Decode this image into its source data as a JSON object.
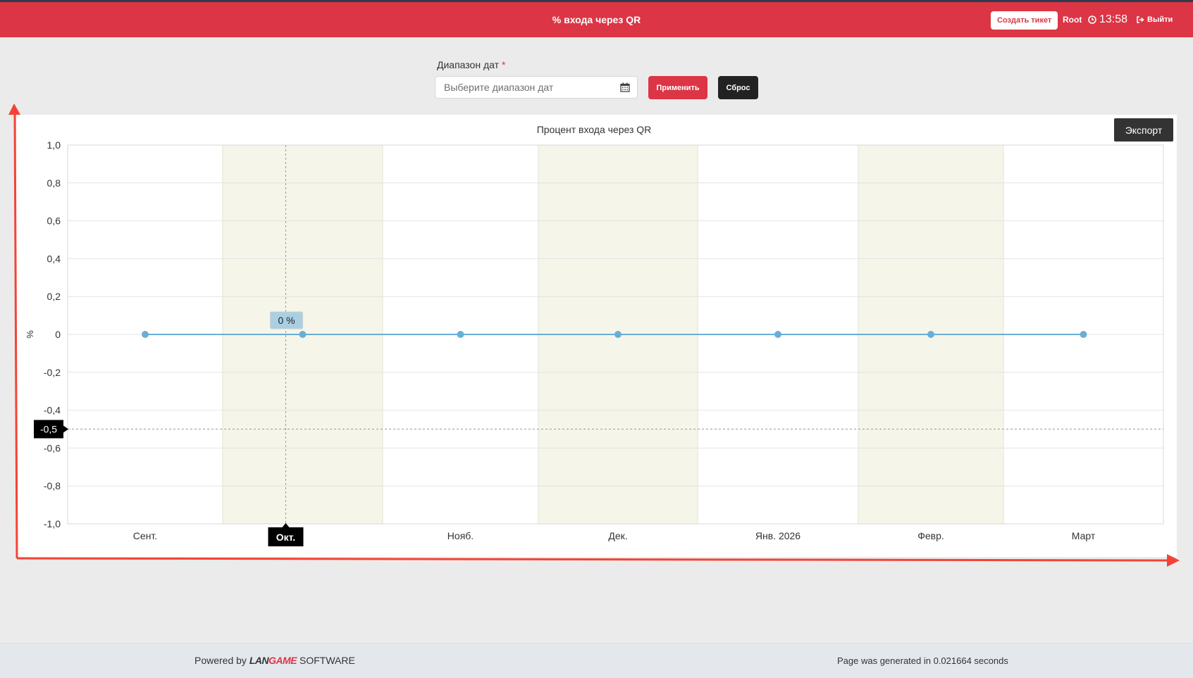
{
  "header": {
    "title": "% входа через QR",
    "create_ticket_label": "Создать тикет",
    "user": "Root",
    "time": "13:58",
    "logout_label": "Выйти",
    "bg_color": "#dc3545"
  },
  "filter": {
    "label": "Диапазон дат",
    "required_mark": "*",
    "placeholder": "Выберите диапазон дат",
    "value": "",
    "apply_label": "Применить",
    "reset_label": "Сброс"
  },
  "export_label": "Экспорт",
  "chart_data": {
    "type": "line",
    "title": "Процент входа через QR",
    "ylabel": "%",
    "xlabel": "",
    "categories": [
      "Сент.",
      "Окт.",
      "Нояб.",
      "Дек.",
      "Янв. 2026",
      "Февр.",
      "Март"
    ],
    "series": [
      {
        "values": [
          0,
          0,
          0,
          0,
          0,
          0,
          0
        ],
        "color": "#6aaed6"
      }
    ],
    "ylim": [
      -1,
      1
    ],
    "yticks": [
      "1,0",
      "0,8",
      "0,6",
      "0,4",
      "0,2",
      "0",
      "-0,2",
      "-0,4",
      "-0,6",
      "-0,8",
      "-1,0"
    ],
    "grid": true,
    "tooltip": {
      "text": "0 %",
      "category": "Окт."
    },
    "crosshair": {
      "x_label": "Окт.",
      "y_label": "-0,5",
      "y_value": -0.5
    },
    "band_color": "#f5f5e9",
    "annotation_arrow_color": "#f44336"
  },
  "footer": {
    "powered_prefix": "Powered by",
    "brand_lan": "LAN",
    "brand_game": "GAME",
    "brand_suffix": "SOFTWARE",
    "generated": "Page was generated in 0.021664 seconds"
  }
}
